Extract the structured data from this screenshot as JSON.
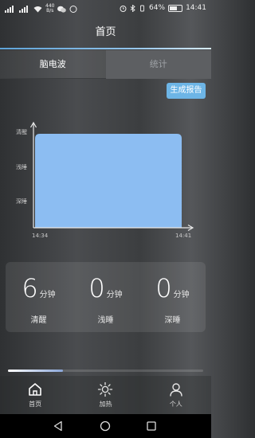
{
  "status_bar": {
    "net_speed": "440",
    "net_unit": "B/s",
    "battery": "64%",
    "battery_level": 0.64,
    "time": "14:41"
  },
  "header": {
    "title": "首页"
  },
  "tabs": [
    {
      "label": "脑电波",
      "active": true
    },
    {
      "label": "统计",
      "active": false
    }
  ],
  "report_button": "生成报告",
  "chart_data": {
    "type": "area",
    "title": "",
    "xlabel": "",
    "ylabel": "",
    "y_categories": [
      "深睡",
      "浅睡",
      "清醒"
    ],
    "x_tick_labels": [
      "14:34",
      "14:41"
    ],
    "points": [
      {
        "t": "14:34",
        "stage": "清醒"
      },
      {
        "t": "14:41",
        "stage": "清醒"
      }
    ],
    "fill_color": "#8cbdf2"
  },
  "stats": [
    {
      "value": "6",
      "unit": "分钟",
      "label": "清醒"
    },
    {
      "value": "0",
      "unit": "分钟",
      "label": "浅睡"
    },
    {
      "value": "0",
      "unit": "分钟",
      "label": "深睡"
    }
  ],
  "progress": {
    "fraction": 0.28
  },
  "bottom_nav": [
    {
      "label": "首页",
      "icon": "home-icon",
      "active": true
    },
    {
      "label": "加热",
      "icon": "sun-icon",
      "active": false
    },
    {
      "label": "个人",
      "icon": "person-icon",
      "active": false
    }
  ],
  "colors": {
    "accent": "#6db5e6",
    "chart_fill": "#8cbdf2"
  }
}
